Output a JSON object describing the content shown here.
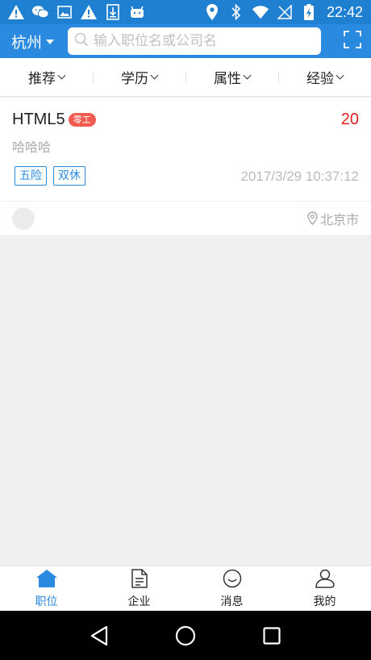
{
  "status_bar": {
    "time": "22:42",
    "left_icons": [
      "warning-icon",
      "wechat-icon",
      "image-icon",
      "warning-icon",
      "download-icon",
      "android-icon"
    ],
    "right_icons": [
      "location-icon",
      "bluetooth-icon",
      "wifi-icon",
      "no-signal-icon",
      "battery-charging-icon"
    ]
  },
  "header": {
    "city": "杭州",
    "search_placeholder": "输入职位名或公司名",
    "scan_icon": "scan-icon"
  },
  "filters": [
    {
      "label": "推荐"
    },
    {
      "label": "学历"
    },
    {
      "label": "属性"
    },
    {
      "label": "经验"
    }
  ],
  "job": {
    "title": "HTML5",
    "badge": "零工",
    "salary": "20",
    "description": "哈哈哈",
    "tags": [
      "五险",
      "双休"
    ],
    "time": "2017/3/29 10:37:12",
    "location": "北京市"
  },
  "bottom_nav": [
    {
      "label": "职位",
      "icon": "home-icon",
      "active": true
    },
    {
      "label": "企业",
      "icon": "document-icon",
      "active": false
    },
    {
      "label": "消息",
      "icon": "smile-icon",
      "active": false
    },
    {
      "label": "我的",
      "icon": "user-icon",
      "active": false
    }
  ],
  "colors": {
    "primary": "#2a8ae0",
    "status_bar": "#1f7fd1",
    "salary": "#e02020",
    "badge": "#f05a4f"
  }
}
